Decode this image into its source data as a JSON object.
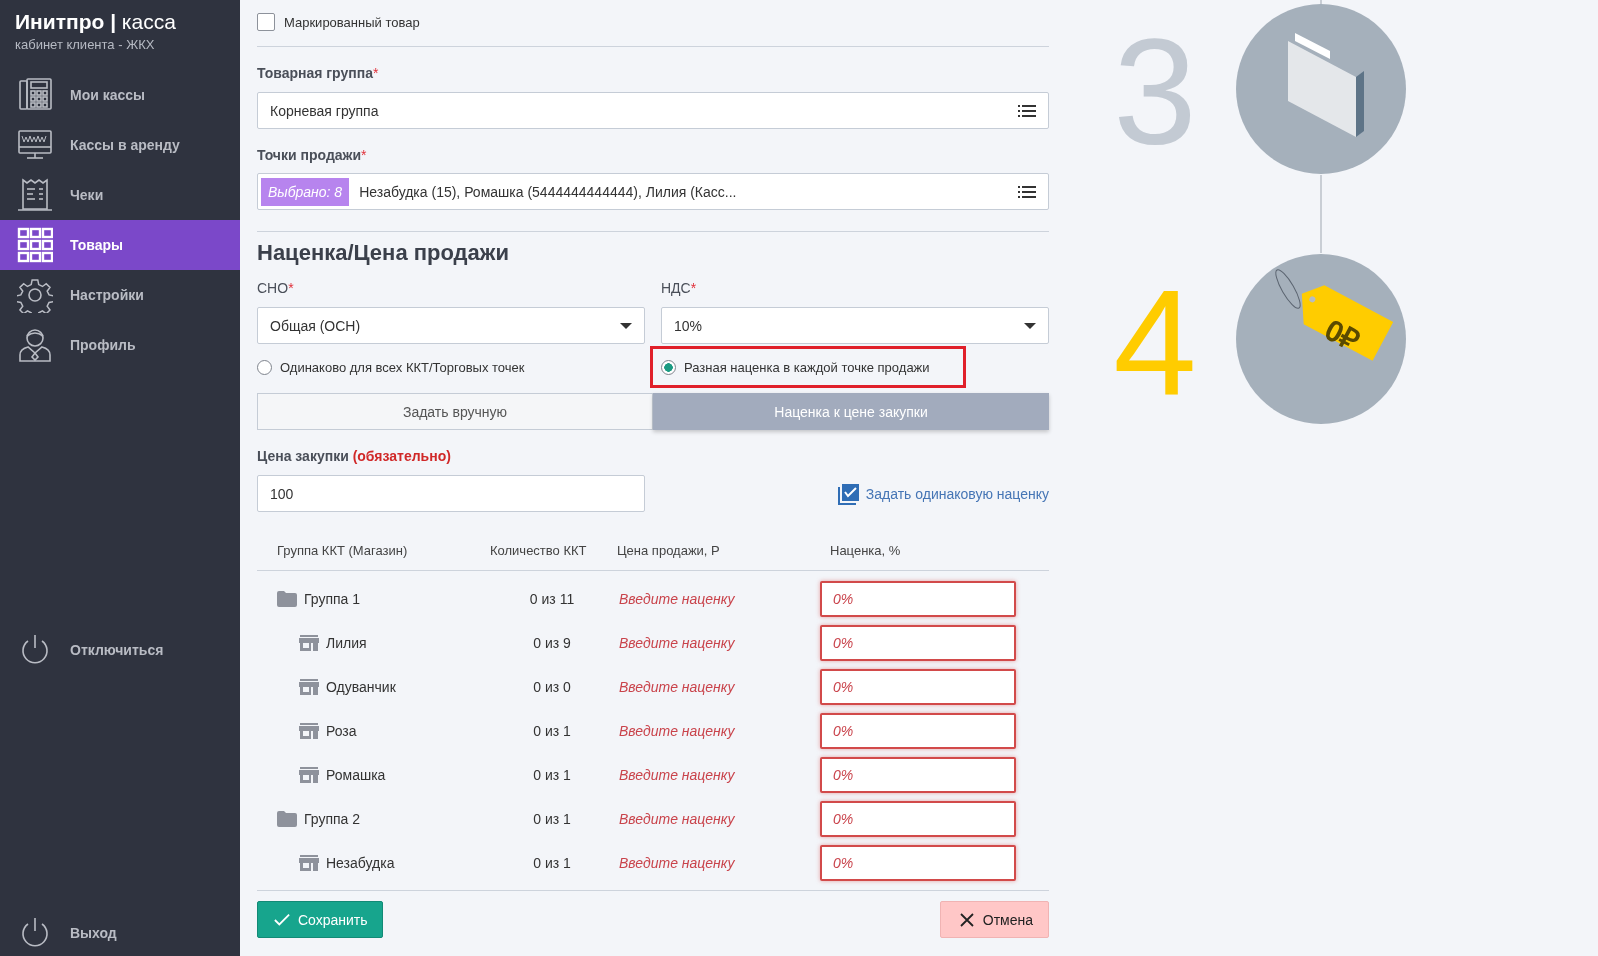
{
  "sidebar": {
    "brand": "**Инитпро |** касса",
    "subtitle": "кабинет клиента - ЖКХ",
    "items": [
      {
        "kind": "register",
        "label": "Мои кассы",
        "selected": false
      },
      {
        "kind": "rent",
        "label": "Кассы в аренду",
        "selected": false
      },
      {
        "kind": "receipts",
        "label": "Чеки",
        "selected": false
      },
      {
        "kind": "goods",
        "label": "Товары",
        "selected": true
      },
      {
        "kind": "settings",
        "label": "Настройки",
        "selected": false
      },
      {
        "kind": "profile",
        "label": "Профиль",
        "selected": false
      }
    ],
    "bottom_items": [
      {
        "kind": "power",
        "label": "Отключиться"
      },
      {
        "kind": "power",
        "label": "Выход"
      }
    ]
  },
  "form": {
    "marked": {
      "label": "Маркированный товар",
      "checked": false
    },
    "product_group": {
      "label": "Товарная группа",
      "asterisk": "*",
      "value": "Корневая группа"
    },
    "sale_points": {
      "label": "Точки продажи",
      "asterisk": "*",
      "badge": "Выбрано: 8",
      "value": "Незабудка (15), Ромашка (5444444444444), Лилия (Касс..."
    },
    "section_title": "Наценка/Цена продажи",
    "sno": {
      "label": "СНО",
      "asterisk": "*",
      "value": "Общая (ОСН)"
    },
    "vat": {
      "label": "НДС",
      "asterisk": "*",
      "value": "10%"
    },
    "markup_modes": [
      {
        "label": "Одинаково для всех ККТ/Торговых точек",
        "selected": false,
        "highlighted": false
      },
      {
        "label": "Разная наценка в каждой точке продажи",
        "selected": true,
        "highlighted": true
      }
    ],
    "price_tabs": [
      {
        "label": "Задать вручную",
        "selected": false
      },
      {
        "label": "Наценка к цене закупки",
        "selected": true
      }
    ],
    "purchase_price": {
      "label": "Цена закупки",
      "note": "(обязательно)",
      "value": "100"
    },
    "same_markup": {
      "label": "Задать одинаковую наценку",
      "checked": true
    },
    "table": {
      "columns": [
        "Группа ККТ (Магазин)",
        "Количество ККТ",
        "Цена продажи, Р",
        "Наценка, %"
      ],
      "rows": [
        {
          "kind": "group",
          "name": "Группа 1",
          "count": "0 из 11",
          "price": "Введите наценку",
          "markup_placeholder": "0%",
          "invalid": true,
          "children": [
            {
              "kind": "store",
              "name": "Лилия",
              "count": "0 из 9",
              "price": "Введите наценку",
              "markup_placeholder": "0%",
              "invalid": true
            },
            {
              "kind": "store",
              "name": "Одуванчик",
              "count": "0 из 0",
              "price": "Введите наценку",
              "markup_placeholder": "0%",
              "invalid": true
            },
            {
              "kind": "store",
              "name": "Роза",
              "count": "0 из 1",
              "price": "Введите наценку",
              "markup_placeholder": "0%",
              "invalid": true
            },
            {
              "kind": "store",
              "name": "Ромашка",
              "count": "0 из 1",
              "price": "Введите наценку",
              "markup_placeholder": "0%",
              "invalid": true
            }
          ]
        },
        {
          "kind": "group",
          "name": "Группа 2",
          "count": "0 из 1",
          "price": "Введите наценку",
          "markup_placeholder": "0%",
          "invalid": true,
          "children": [
            {
              "kind": "store",
              "name": "Незабудка",
              "count": "0 из 1",
              "price": "Введите наценку",
              "markup_placeholder": "0%",
              "invalid": true
            }
          ]
        }
      ]
    },
    "save": "Сохранить",
    "cancel": "Отмена"
  },
  "steps": [
    {
      "number": "3",
      "active": false,
      "kind": "folder"
    },
    {
      "number": "4",
      "active": true,
      "kind": "price-tag",
      "tag_text": "0₽"
    }
  ]
}
